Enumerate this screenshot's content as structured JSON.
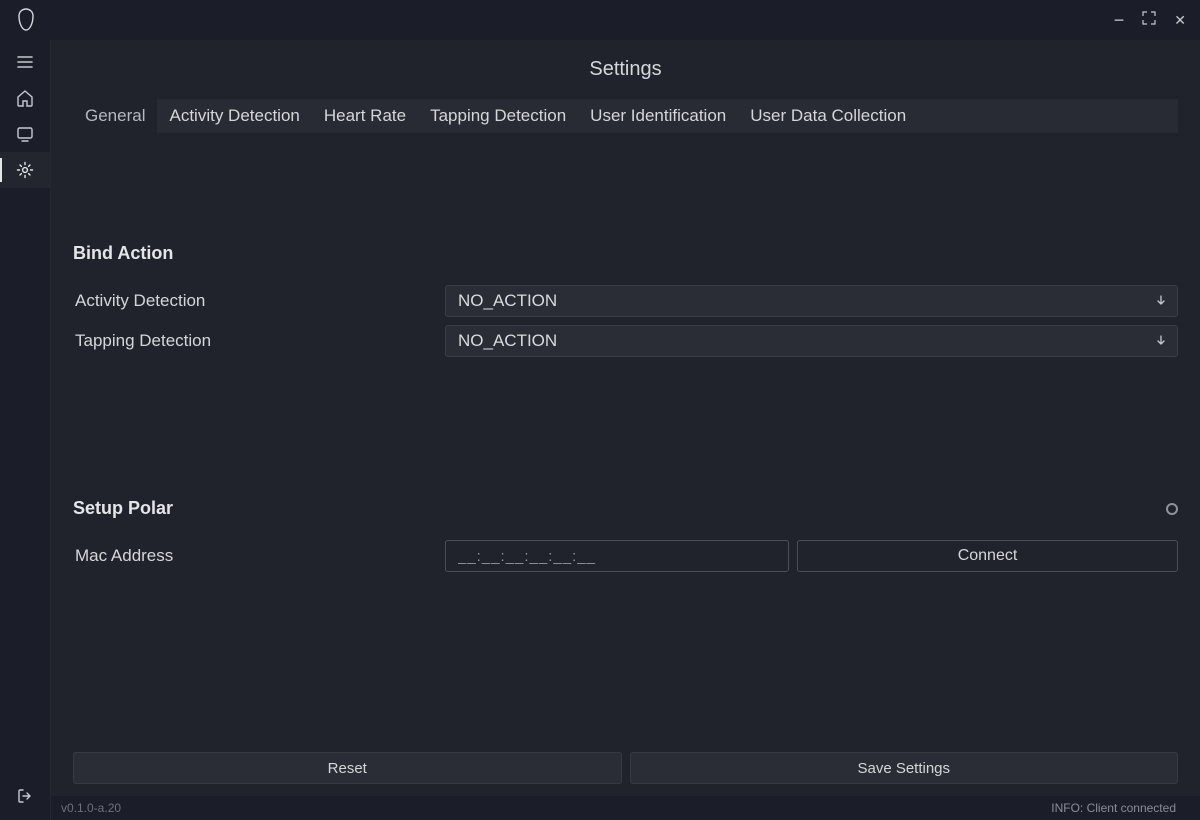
{
  "window": {
    "controls": {
      "minimize": "−",
      "maximize": "⛶",
      "close": "✕"
    }
  },
  "sidebar": {
    "activeIndex": 3
  },
  "page": {
    "title": "Settings"
  },
  "tabs": [
    {
      "label": "General",
      "active": true
    },
    {
      "label": "Activity Detection",
      "active": false
    },
    {
      "label": "Heart Rate",
      "active": false
    },
    {
      "label": "Tapping Detection",
      "active": false
    },
    {
      "label": "User Identification",
      "active": false
    },
    {
      "label": "User Data Collection",
      "active": false
    }
  ],
  "sections": {
    "bindAction": {
      "title": "Bind Action",
      "rows": [
        {
          "label": "Activity Detection",
          "value": "NO_ACTION"
        },
        {
          "label": "Tapping Detection",
          "value": "NO_ACTION"
        }
      ]
    },
    "setupPolar": {
      "title": "Setup Polar",
      "macLabel": "Mac Address",
      "macPlaceholder": "__:__:__:__:__:__",
      "macValue": "",
      "connectLabel": "Connect"
    }
  },
  "footer": {
    "resetLabel": "Reset",
    "saveLabel": "Save Settings"
  },
  "statusbar": {
    "version": "v0.1.0-a.20",
    "info": "INFO: Client connected"
  }
}
